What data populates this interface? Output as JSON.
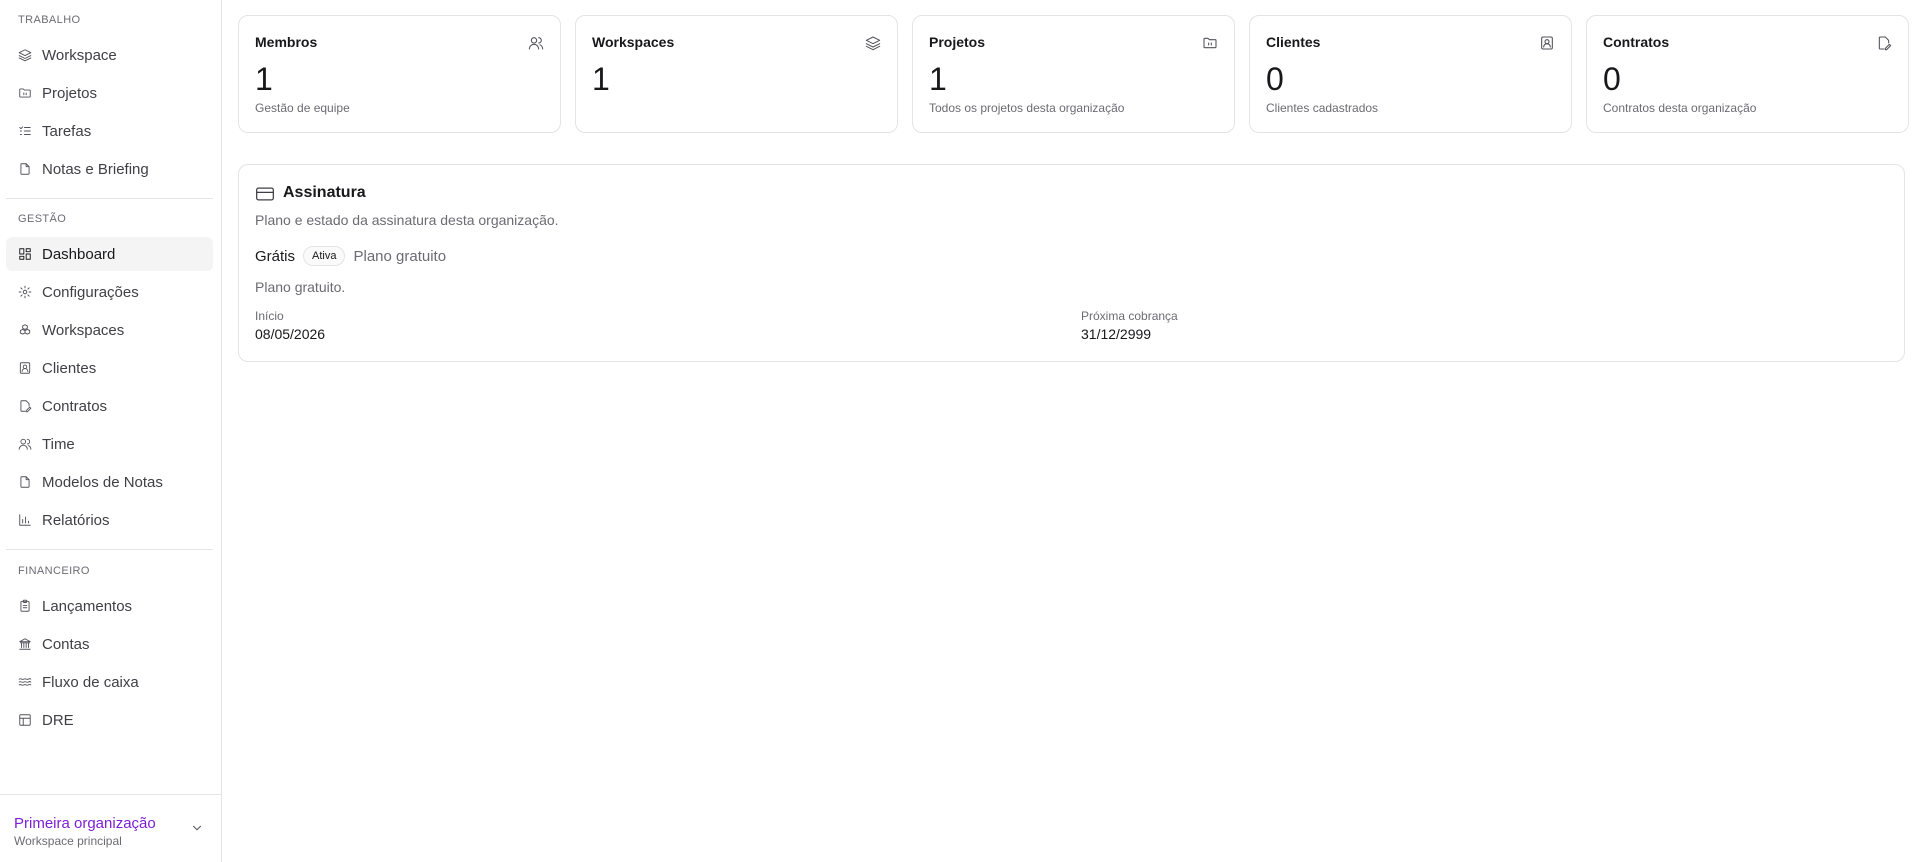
{
  "sidebar": {
    "sections": [
      {
        "label": "TRABALHO",
        "items": [
          {
            "label": "Workspace",
            "icon": "layers-icon"
          },
          {
            "label": "Projetos",
            "icon": "folder-icon"
          },
          {
            "label": "Tarefas",
            "icon": "list-checks-icon"
          },
          {
            "label": "Notas e Briefing",
            "icon": "file-icon"
          }
        ]
      },
      {
        "label": "GESTÃO",
        "items": [
          {
            "label": "Dashboard",
            "icon": "layout-dashboard-icon",
            "active": true
          },
          {
            "label": "Configurações",
            "icon": "gear-icon"
          },
          {
            "label": "Workspaces",
            "icon": "boxes-icon"
          },
          {
            "label": "Clientes",
            "icon": "contact-icon"
          },
          {
            "label": "Contratos",
            "icon": "file-pen-icon"
          },
          {
            "label": "Time",
            "icon": "users-icon"
          },
          {
            "label": "Modelos de Notas",
            "icon": "file-icon"
          },
          {
            "label": "Relatórios",
            "icon": "bar-chart-icon"
          }
        ]
      },
      {
        "label": "FINANCEIRO",
        "items": [
          {
            "label": "Lançamentos",
            "icon": "clipboard-list-icon"
          },
          {
            "label": "Contas",
            "icon": "bank-icon"
          },
          {
            "label": "Fluxo de caixa",
            "icon": "waves-icon"
          },
          {
            "label": "DRE",
            "icon": "table-icon"
          }
        ]
      }
    ],
    "org": {
      "name": "Primeira organização",
      "subtitle": "Workspace principal",
      "icon": "chevron-down-icon"
    }
  },
  "stats": [
    {
      "title": "Membros",
      "value": "1",
      "desc": "Gestão de equipe",
      "icon": "users-icon"
    },
    {
      "title": "Workspaces",
      "value": "1",
      "desc": "",
      "icon": "layers-icon"
    },
    {
      "title": "Projetos",
      "value": "1",
      "desc": "Todos os projetos desta organização",
      "icon": "folder-icon"
    },
    {
      "title": "Clientes",
      "value": "0",
      "desc": "Clientes cadastrados",
      "icon": "contact-icon"
    },
    {
      "title": "Contratos",
      "value": "0",
      "desc": "Contratos desta organização",
      "icon": "file-pen-icon"
    }
  ],
  "subscription": {
    "icon": "credit-card-icon",
    "title": "Assinatura",
    "description": "Plano e estado da assinatura desta organização.",
    "plan_name": "Grátis",
    "status_badge": "Ativa",
    "plan_label": "Plano gratuito",
    "plan_note": "Plano gratuito.",
    "start_label": "Início",
    "start_value": "08/05/2026",
    "next_label": "Próxima cobrança",
    "next_value": "31/12/2999"
  },
  "colors": {
    "accent": "#7c1fd6",
    "border": "#e4e4e7",
    "muted_text": "#6b6b74",
    "active_bg": "#f4f4f5"
  }
}
